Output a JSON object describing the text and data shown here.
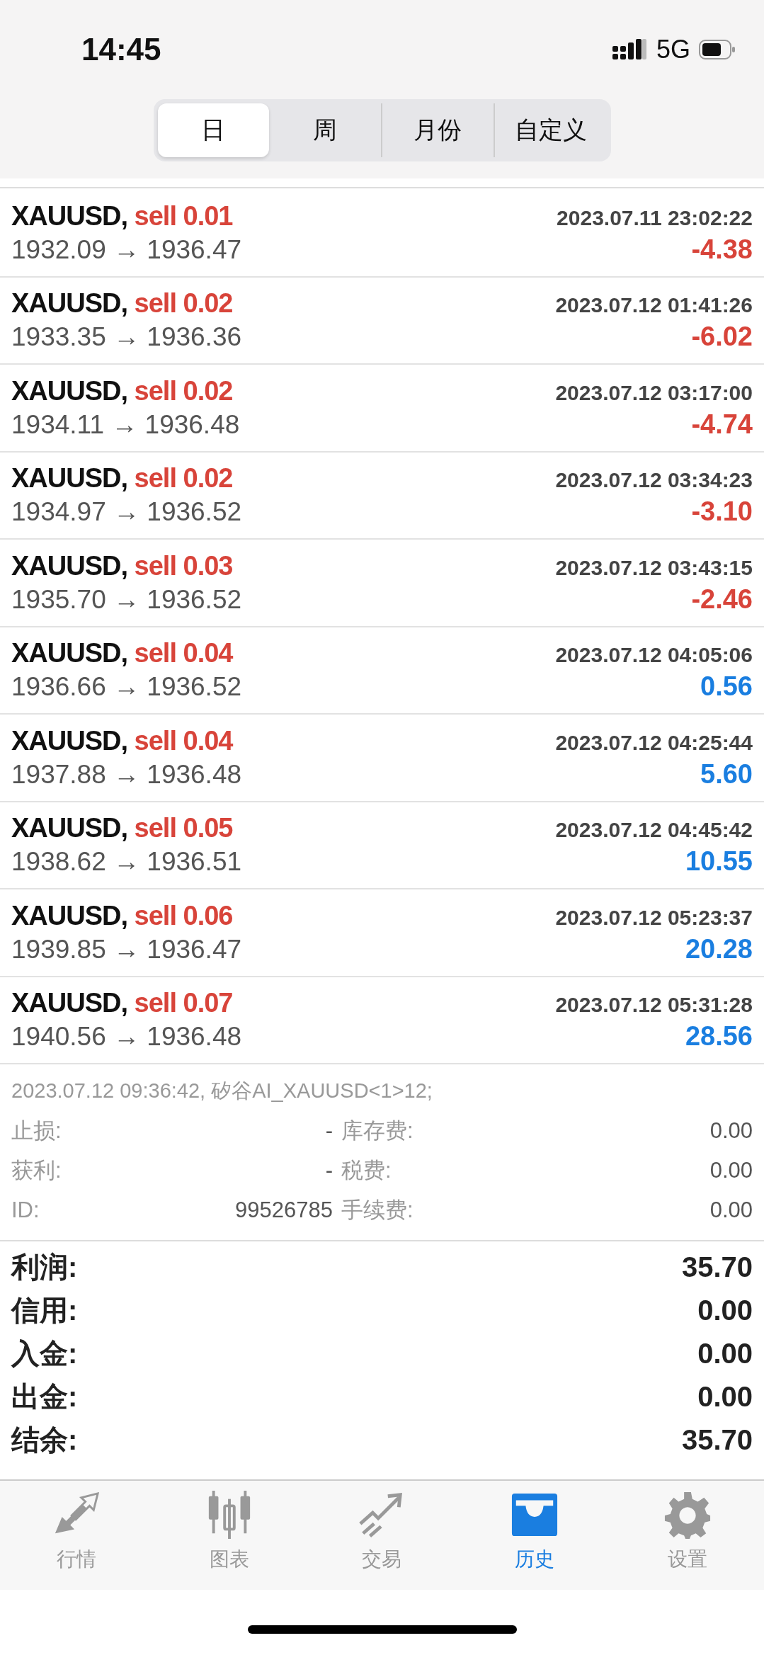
{
  "status_bar": {
    "time": "14:45",
    "network": "5G"
  },
  "tabs": [
    {
      "label": "日",
      "selected": true
    },
    {
      "label": "周",
      "selected": false
    },
    {
      "label": "月份",
      "selected": false
    },
    {
      "label": "自定义",
      "selected": false
    }
  ],
  "trades": [
    {
      "symbol": "XAUUSD,",
      "side": "sell 0.01",
      "time": "2023.07.11 23:02:22",
      "prices": "1932.09 → 1936.47",
      "profit": "-4.38",
      "color": "#d8443a"
    },
    {
      "symbol": "XAUUSD,",
      "side": "sell 0.02",
      "time": "2023.07.12 01:41:26",
      "prices": "1933.35 → 1936.36",
      "profit": "-6.02",
      "color": "#d8443a"
    },
    {
      "symbol": "XAUUSD,",
      "side": "sell 0.02",
      "time": "2023.07.12 03:17:00",
      "prices": "1934.11 → 1936.48",
      "profit": "-4.74",
      "color": "#d8443a"
    },
    {
      "symbol": "XAUUSD,",
      "side": "sell 0.02",
      "time": "2023.07.12 03:34:23",
      "prices": "1934.97 → 1936.52",
      "profit": "-3.10",
      "color": "#d8443a"
    },
    {
      "symbol": "XAUUSD,",
      "side": "sell 0.03",
      "time": "2023.07.12 03:43:15",
      "prices": "1935.70 → 1936.52",
      "profit": "-2.46",
      "color": "#d8443a"
    },
    {
      "symbol": "XAUUSD,",
      "side": "sell 0.04",
      "time": "2023.07.12 04:05:06",
      "prices": "1936.66 → 1936.52",
      "profit": "0.56",
      "color": "#1a7ee0"
    },
    {
      "symbol": "XAUUSD,",
      "side": "sell 0.04",
      "time": "2023.07.12 04:25:44",
      "prices": "1937.88 → 1936.48",
      "profit": "5.60",
      "color": "#1a7ee0"
    },
    {
      "symbol": "XAUUSD,",
      "side": "sell 0.05",
      "time": "2023.07.12 04:45:42",
      "prices": "1938.62 → 1936.51",
      "profit": "10.55",
      "color": "#1a7ee0"
    },
    {
      "symbol": "XAUUSD,",
      "side": "sell 0.06",
      "time": "2023.07.12 05:23:37",
      "prices": "1939.85 → 1936.47",
      "profit": "20.28",
      "color": "#1a7ee0"
    },
    {
      "symbol": "XAUUSD,",
      "side": "sell 0.07",
      "time": "2023.07.12 05:31:28",
      "prices": "1940.56 → 1936.48",
      "profit": "28.56",
      "color": "#1a7ee0"
    }
  ],
  "comment": "2023.07.12 09:36:42, 矽谷AI_XAUUSD<1>12;",
  "details": [
    {
      "label": "止损:",
      "value": "-",
      "label_2": "库存费:",
      "value_2": "0.00"
    },
    {
      "label": "获利:",
      "value": "-",
      "label_2": "税费:",
      "value_2": "0.00"
    },
    {
      "label": "ID:",
      "value": "99526785",
      "label_2": "手续费:",
      "value_2": "0.00"
    }
  ],
  "summary": [
    {
      "label": "利润:",
      "value": "35.70"
    },
    {
      "label": "信用:",
      "value": "0.00"
    },
    {
      "label": "入金:",
      "value": "0.00"
    },
    {
      "label": "出金:",
      "value": "0.00"
    },
    {
      "label": "结余:",
      "value": "35.70"
    }
  ],
  "nav": [
    {
      "kind": "quotes",
      "label": "行情",
      "selected": false
    },
    {
      "kind": "chart",
      "label": "图表",
      "selected": false
    },
    {
      "kind": "trade",
      "label": "交易",
      "selected": false
    },
    {
      "kind": "history",
      "label": "历史",
      "selected": true
    },
    {
      "kind": "settings",
      "label": "设置",
      "selected": false
    }
  ]
}
